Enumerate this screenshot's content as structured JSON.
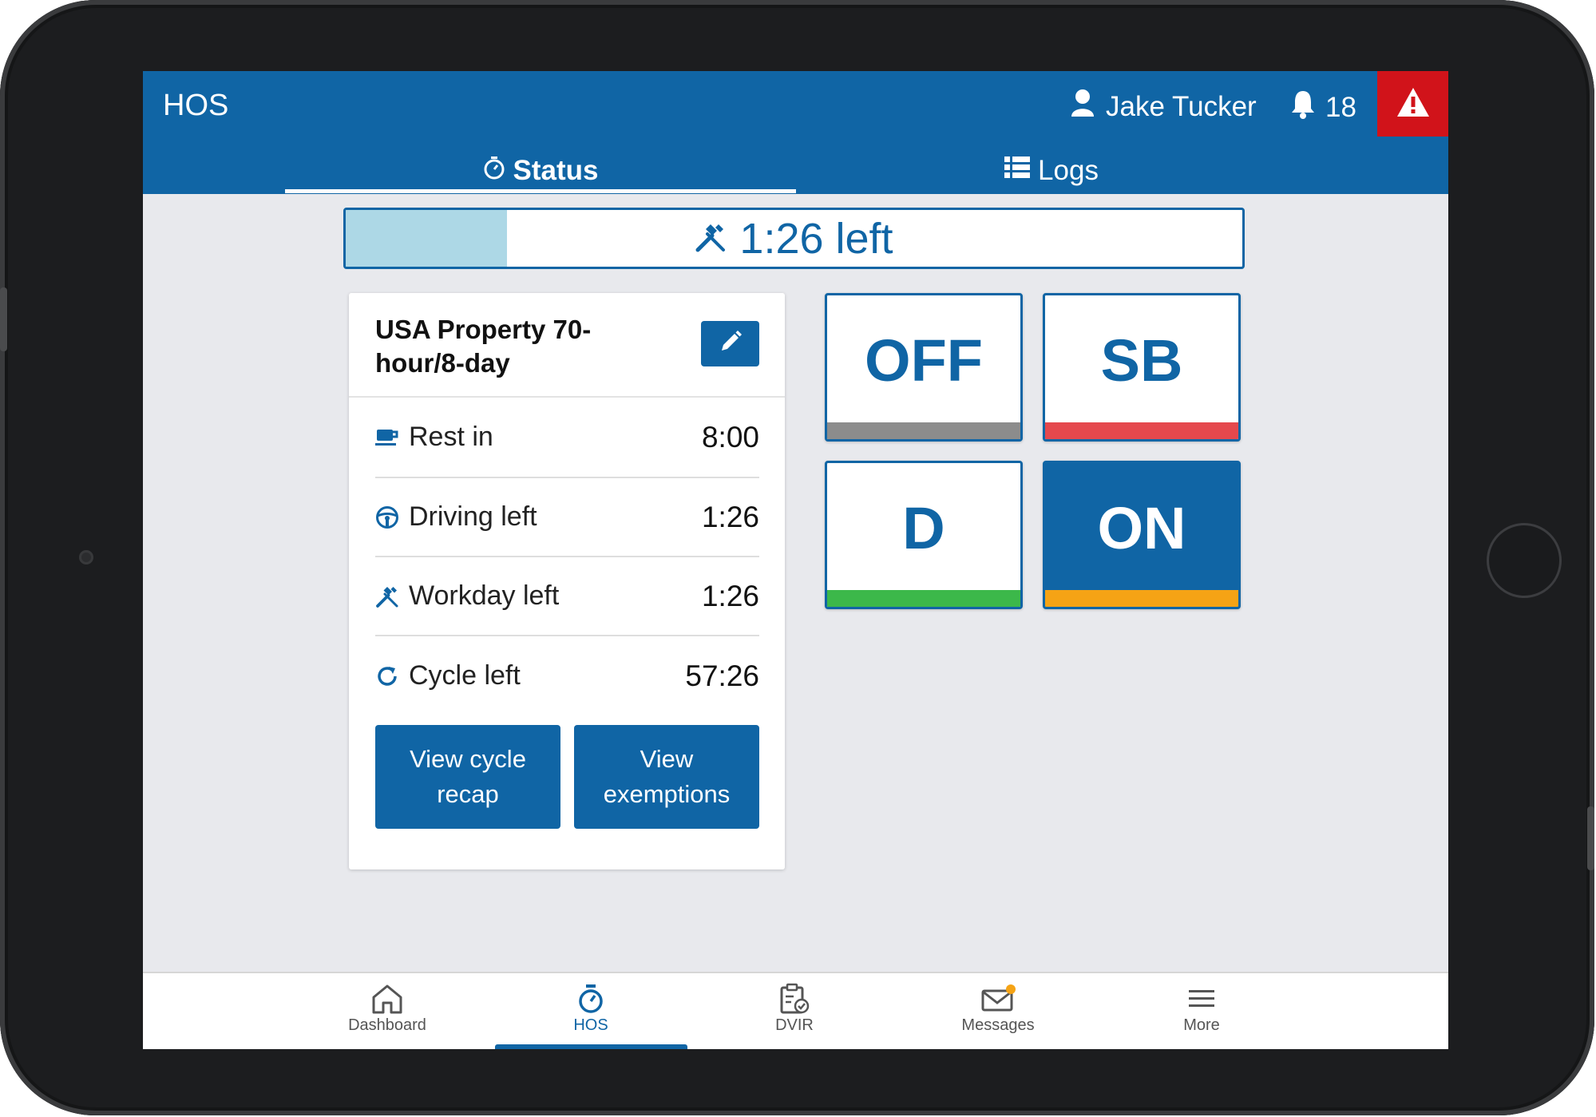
{
  "header": {
    "title": "HOS",
    "user_name": "Jake Tucker",
    "notification_count": "18"
  },
  "tabs": [
    {
      "label": "Status",
      "active": true
    },
    {
      "label": "Logs",
      "active": false
    }
  ],
  "progress": {
    "label": "1:26 left",
    "fill_fraction": 0.18
  },
  "ruleset": {
    "title": "USA Property 70-hour/8-day"
  },
  "timers": [
    {
      "label": "Rest in",
      "value": "8:00",
      "icon": "coffee-cup-icon"
    },
    {
      "label": "Driving left",
      "value": "1:26",
      "icon": "steering-wheel-icon"
    },
    {
      "label": "Workday left",
      "value": "1:26",
      "icon": "tools-icon"
    },
    {
      "label": "Cycle left",
      "value": "57:26",
      "icon": "cycle-icon"
    }
  ],
  "actions": {
    "view_cycle_recap": "View cycle recap",
    "view_exemptions": "View exemptions"
  },
  "duty_status": [
    {
      "label": "OFF",
      "color": "#8c8c8c",
      "active": false
    },
    {
      "label": "SB",
      "color": "#e5484d",
      "active": false
    },
    {
      "label": "D",
      "color": "#3cb84a",
      "active": false
    },
    {
      "label": "ON",
      "color": "#f5a315",
      "active": true
    }
  ],
  "bottom_nav": [
    {
      "label": "Dashboard",
      "icon": "home-icon",
      "active": false
    },
    {
      "label": "HOS",
      "icon": "stopwatch-icon",
      "active": true
    },
    {
      "label": "DVIR",
      "icon": "clipboard-check-icon",
      "active": false
    },
    {
      "label": "Messages",
      "icon": "envelope-icon",
      "active": false
    },
    {
      "label": "More",
      "icon": "hamburger-icon",
      "active": false
    }
  ],
  "colors": {
    "primary": "#1065a5",
    "alert": "#d1131a",
    "progress_fill": "#add8e6",
    "background": "#e8e9ed"
  }
}
